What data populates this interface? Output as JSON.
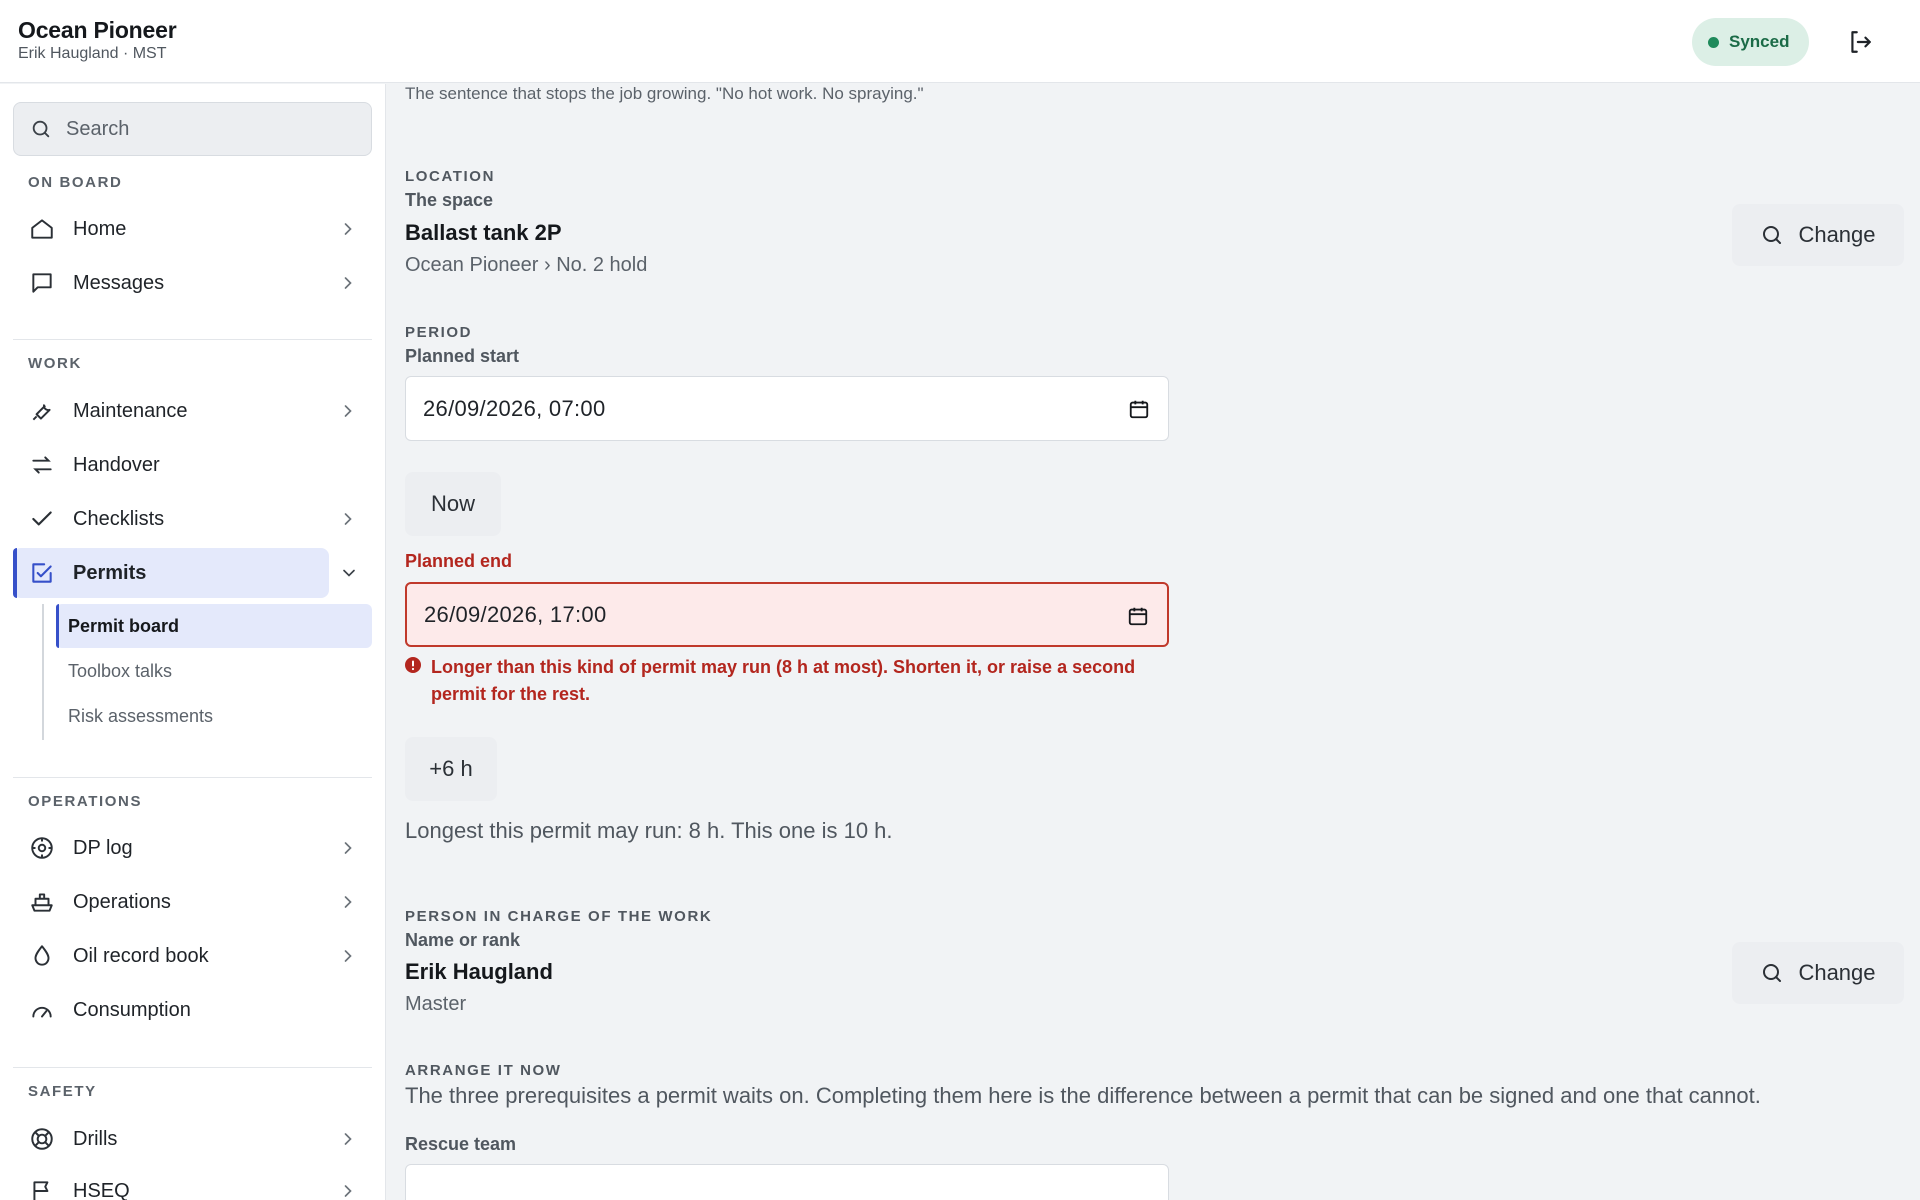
{
  "header": {
    "vessel_name": "Ocean Pioneer",
    "user_line": "Erik Haugland · MST",
    "sync_status": "Synced",
    "sync_color": "#1f8a5b",
    "logout_icon": "logout-icon"
  },
  "sidebar": {
    "search_placeholder": "Search",
    "sections": {
      "on_board": "ON BOARD",
      "work": "WORK",
      "operations": "OPERATIONS",
      "safety": "SAFETY"
    },
    "items": {
      "home": "Home",
      "messages": "Messages",
      "maintenance": "Maintenance",
      "handover": "Handover",
      "checklists": "Checklists",
      "permits": "Permits",
      "dp_log": "DP log",
      "operations": "Operations",
      "oil_record_book": "Oil record book",
      "consumption": "Consumption",
      "drills": "Drills",
      "hseq": "HSEQ"
    },
    "permit_sub": {
      "permit_board": "Permit board",
      "toolbox_talks": "Toolbox talks",
      "risk_assessments": "Risk assessments"
    },
    "accent_color": "#3650c9"
  },
  "form": {
    "scope_note": "The sentence that stops the job growing. \"No hot work. No spraying.\"",
    "location": {
      "section": "LOCATION",
      "label": "The space",
      "value": "Ballast tank 2P",
      "path": "Ocean Pioneer › No. 2 hold",
      "change_label": "Change"
    },
    "period": {
      "section": "PERIOD",
      "start_label": "Planned start",
      "start_value": "26/09/2026, 07:00",
      "now_button": "Now",
      "end_label": "Planned end",
      "end_value": "26/09/2026, 17:00",
      "error": "Longer than this kind of permit may run (8 h at most). Shorten it, or raise a second permit for the rest.",
      "error_color": "#b3261e",
      "extend_button": "+6 h",
      "limit_note": "Longest this permit may run: 8 h. This one is 10 h."
    },
    "person": {
      "section": "PERSON IN CHARGE OF THE WORK",
      "label": "Name or rank",
      "value": "Erik Haugland",
      "rank": "Master",
      "change_label": "Change"
    },
    "arrange": {
      "section": "ARRANGE IT NOW",
      "description": "The three prerequisites a permit waits on. Completing them here is the difference between a permit that can be signed and one that cannot.",
      "rescue_label": "Rescue team",
      "rescue_value": ""
    }
  }
}
